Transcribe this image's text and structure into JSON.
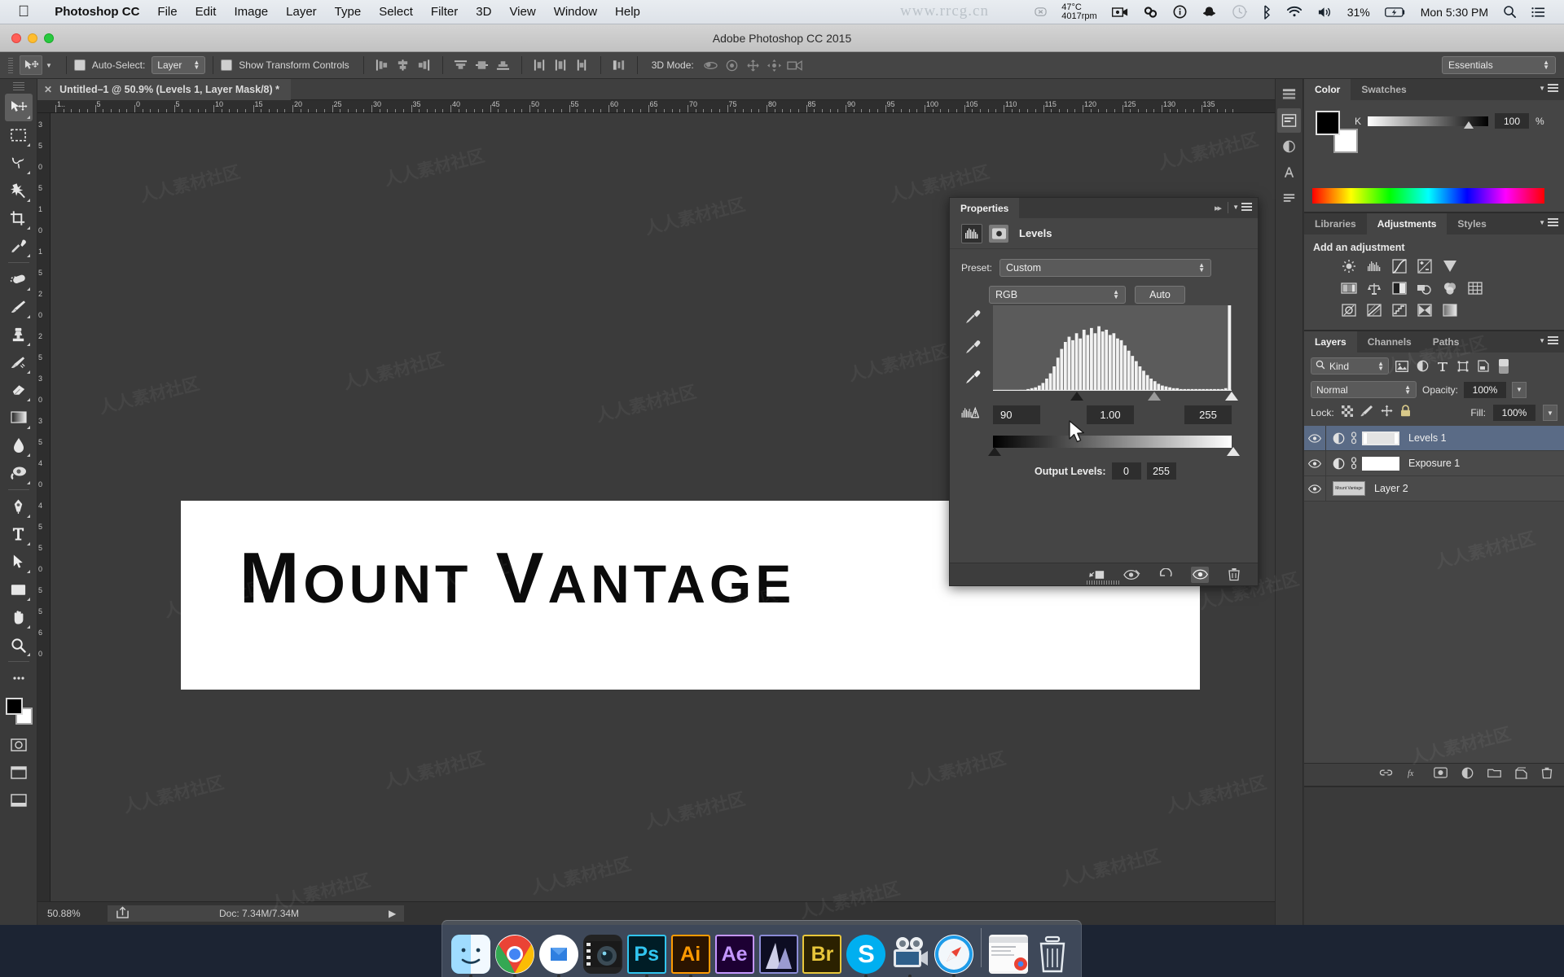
{
  "menubar": {
    "apple_icon": "apple-logo-icon",
    "items": [
      "Photoshop CC",
      "File",
      "Edit",
      "Image",
      "Layer",
      "Type",
      "Select",
      "Filter",
      "3D",
      "View",
      "Window",
      "Help"
    ],
    "status": {
      "watermark_text": "www.rrcg.cn",
      "temperature": "47°C",
      "fan_speed": "4017rpm",
      "icons": [
        "close-circle-icon",
        "screen-record-icon",
        "creative-cloud-icon",
        "info-circle-icon",
        "snapchat-icon",
        "time-machine-icon",
        "bluetooth-icon",
        "wifi-icon",
        "volume-icon"
      ],
      "battery_percent": "31%",
      "battery_icon": "battery-charging-icon",
      "clock": "Mon 5:30 PM",
      "search_icon": "search-icon",
      "notification_icon": "notification-center-icon"
    }
  },
  "titlebar": {
    "title": "Adobe Photoshop CC 2015"
  },
  "optionsbar": {
    "tool_icon": "move-tool-icon",
    "tool_preset_caret": "chevron-down-icon",
    "autoselect_label": "Auto-Select:",
    "autoselect_value": "Layer",
    "show_transform_label": "Show Transform Controls",
    "align_icons": [
      "align-left-edges-icon",
      "align-horizontal-centers-icon",
      "align-right-edges-icon",
      "align-top-edges-icon",
      "align-vertical-centers-icon",
      "align-bottom-edges-icon"
    ],
    "distribute_icons": [
      "distribute-top-icon",
      "distribute-vertical-center-icon",
      "distribute-bottom-icon",
      "distribute-left-icon",
      "distribute-horizontal-center-icon",
      "distribute-right-icon",
      "auto-align-icon"
    ],
    "mode3d_label": "3D Mode:",
    "mode3d_icons": [
      "3d-rotate-icon",
      "3d-roll-icon",
      "3d-pan-icon",
      "3d-slide-icon",
      "3d-camera-icon"
    ],
    "workspace": "Essentials"
  },
  "toolbar": {
    "tools": [
      "move-tool-icon",
      "rectangular-marquee-icon",
      "lasso-tool-icon",
      "magic-wand-icon",
      "crop-tool-icon",
      "eyedropper-tool-icon",
      "healing-brush-icon",
      "brush-tool-icon",
      "clone-stamp-icon",
      "history-brush-icon",
      "eraser-tool-icon",
      "gradient-tool-icon",
      "blur-tool-icon",
      "dodge-tool-icon",
      "pen-tool-icon",
      "type-tool-icon",
      "path-selection-icon",
      "rectangle-shape-icon",
      "hand-tool-icon",
      "zoom-tool-icon"
    ],
    "foreground_color": "#000000",
    "background_color": "#ffffff",
    "bottom_icons": [
      "quick-mask-icon",
      "screen-mode-icon",
      "screen-mode-full-icon"
    ]
  },
  "document": {
    "tab_title": "Untitled–1 @ 50.9% (Levels 1, Layer Mask/8) *",
    "close_icon": "close-icon",
    "artwork_text": "Mount Vantage",
    "ruler_labels_h": [
      "1..",
      "5",
      "0",
      "5",
      "10",
      "15",
      "20",
      "25",
      "30",
      "35",
      "40",
      "45",
      "50",
      "55",
      "60",
      "65",
      "70",
      "75",
      "80",
      "85",
      "90",
      "95",
      "100",
      "105",
      "110",
      "115",
      "120",
      "125",
      "130",
      "135"
    ],
    "ruler_labels_v": [
      "3",
      "5",
      "0",
      "5",
      "1",
      "0",
      "1",
      "5",
      "2",
      "0",
      "2",
      "5",
      "3",
      "0",
      "3",
      "5",
      "4",
      "0",
      "4",
      "5",
      "5",
      "0",
      "5",
      "5",
      "6",
      "0"
    ],
    "statusbar": {
      "zoom": "50.88%",
      "share_icon": "share-icon",
      "doc_size": "Doc: 7.34M/7.34M",
      "expand_icon": "play-arrow-icon"
    }
  },
  "properties_panel": {
    "tab_label": "Properties",
    "collapse_icon": "double-chevron-right-icon",
    "menu_icon": "panel-menu-icon",
    "header": {
      "histogram_icon": "levels-histogram-icon",
      "mask_icon": "layer-mask-icon",
      "title": "Levels"
    },
    "preset_label": "Preset:",
    "preset_value": "Custom",
    "channel_value": "RGB",
    "auto_label": "Auto",
    "eyedroppers": [
      "set-black-point-eyedropper-icon",
      "set-gray-point-eyedropper-icon",
      "set-white-point-eyedropper-icon"
    ],
    "input_levels": {
      "black": "90",
      "gamma": "1.00",
      "white": "255"
    },
    "warning_icon": "clipped-histogram-warning-icon",
    "output_levels_label": "Output Levels:",
    "output_levels": {
      "black": "0",
      "white": "255"
    },
    "footer_icons": [
      "clip-to-layer-icon",
      "view-previous-state-icon",
      "reset-icon",
      "toggle-visibility-icon",
      "delete-adjustment-icon"
    ],
    "histogram": {
      "type": "histogram",
      "bins": 64,
      "values": [
        0,
        0,
        0,
        0,
        0,
        0,
        0,
        1,
        1,
        2,
        3,
        4,
        6,
        9,
        14,
        20,
        28,
        38,
        48,
        56,
        62,
        58,
        66,
        60,
        70,
        64,
        72,
        66,
        74,
        68,
        70,
        64,
        66,
        60,
        58,
        52,
        46,
        40,
        34,
        28,
        23,
        18,
        14,
        11,
        8,
        6,
        5,
        4,
        3,
        3,
        2,
        2,
        2,
        2,
        2,
        2,
        2,
        2,
        2,
        2,
        2,
        2,
        3,
        98
      ],
      "black_point": 90,
      "gamma": 1.0,
      "white_point": 255
    }
  },
  "color_panel": {
    "tabs": [
      "Color",
      "Swatches"
    ],
    "active_tab": "Color",
    "channel_label": "K",
    "channel_value": "100",
    "unit": "%",
    "foreground": "#000000",
    "background": "#ffffff"
  },
  "adjustments_panel": {
    "tabs": [
      "Libraries",
      "Adjustments",
      "Styles"
    ],
    "active_tab": "Adjustments",
    "heading": "Add an adjustment",
    "row1": [
      "brightness-contrast-icon",
      "levels-icon",
      "curves-icon",
      "exposure-icon",
      "vibrance-icon"
    ],
    "row2": [
      "hue-saturation-icon",
      "color-balance-icon",
      "black-white-icon",
      "photo-filter-icon",
      "channel-mixer-icon",
      "color-lookup-icon"
    ],
    "row3": [
      "invert-icon",
      "posterize-icon",
      "threshold-icon",
      "selective-color-icon",
      "gradient-map-icon"
    ]
  },
  "layers_panel": {
    "tabs": [
      "Layers",
      "Channels",
      "Paths"
    ],
    "active_tab": "Layers",
    "filter_label": "Kind",
    "filter_icon": "search-icon",
    "filter_type_icons": [
      "filter-pixel-icon",
      "filter-adjustment-icon",
      "filter-type-icon",
      "filter-shape-icon",
      "filter-smart-object-icon"
    ],
    "filter_toggle_icon": "filter-toggle-icon",
    "blend_mode": "Normal",
    "opacity_label": "Opacity:",
    "opacity_value": "100%",
    "lock_label": "Lock:",
    "lock_icons": [
      "lock-transparent-pixels-icon",
      "lock-image-pixels-icon",
      "lock-position-icon",
      "lock-all-icon"
    ],
    "fill_label": "Fill:",
    "fill_value": "100%",
    "layers": [
      {
        "name": "Levels 1",
        "visible": true,
        "selected": true,
        "type": "adjustment",
        "linked": true,
        "has_mask": true
      },
      {
        "name": "Exposure 1",
        "visible": true,
        "selected": false,
        "type": "adjustment",
        "linked": true,
        "has_mask": true
      },
      {
        "name": "Layer 2",
        "visible": true,
        "selected": false,
        "type": "pixel",
        "linked": false,
        "has_mask": false,
        "thumb_text": "Mount Vantage"
      }
    ],
    "footer_icons": [
      "link-layers-icon",
      "layer-style-icon",
      "add-layer-mask-icon",
      "new-adjustment-layer-icon",
      "new-group-icon",
      "new-layer-icon",
      "delete-layer-icon"
    ]
  },
  "icon_dock": {
    "icons": [
      "history-panel-icon",
      "properties-panel-icon",
      "adjustments-panel-icon",
      "character-panel-icon",
      "paragraph-panel-icon"
    ]
  },
  "dock": {
    "apps": [
      {
        "name": "Finder",
        "glyph": "☺",
        "bg": "#3aa8e8",
        "label": "finder-icon"
      },
      {
        "name": "Google Chrome",
        "glyph": "",
        "bg": "#ffffff",
        "label": "chrome-icon"
      },
      {
        "name": "Mail",
        "glyph": "✉",
        "bg": "#ffffff",
        "label": "mail-icon"
      },
      {
        "name": "QuickTime",
        "glyph": "◉",
        "bg": "#2b2b2b",
        "label": "video-player-icon"
      },
      {
        "name": "Ps",
        "glyph": "Ps",
        "bg": "#001d26",
        "label": "photoshop-icon"
      },
      {
        "name": "Ai",
        "glyph": "Ai",
        "bg": "#2b1400",
        "label": "illustrator-icon"
      },
      {
        "name": "Ae",
        "glyph": "Ae",
        "bg": "#1d0033",
        "label": "after-effects-icon"
      },
      {
        "name": "Pr",
        "glyph": "",
        "bg": "#141432",
        "label": "premiere-icon"
      },
      {
        "name": "Br",
        "glyph": "Br",
        "bg": "#2b2100",
        "label": "bridge-icon"
      },
      {
        "name": "Skype",
        "glyph": "S",
        "bg": "#00aff0",
        "label": "skype-icon"
      },
      {
        "name": "iMovie",
        "glyph": "🎬",
        "bg": "#5b6a7a",
        "label": "imovie-icon"
      },
      {
        "name": "Safari",
        "glyph": "🧭",
        "bg": "#1e9be8",
        "label": "safari-icon"
      }
    ],
    "right_items": [
      {
        "name": "Downloads",
        "label": "downloads-stack-icon"
      },
      {
        "name": "Trash",
        "label": "trash-icon"
      }
    ]
  },
  "watermarks": {
    "text": "人人素材社区",
    "positions": "repeated-diagonal"
  }
}
